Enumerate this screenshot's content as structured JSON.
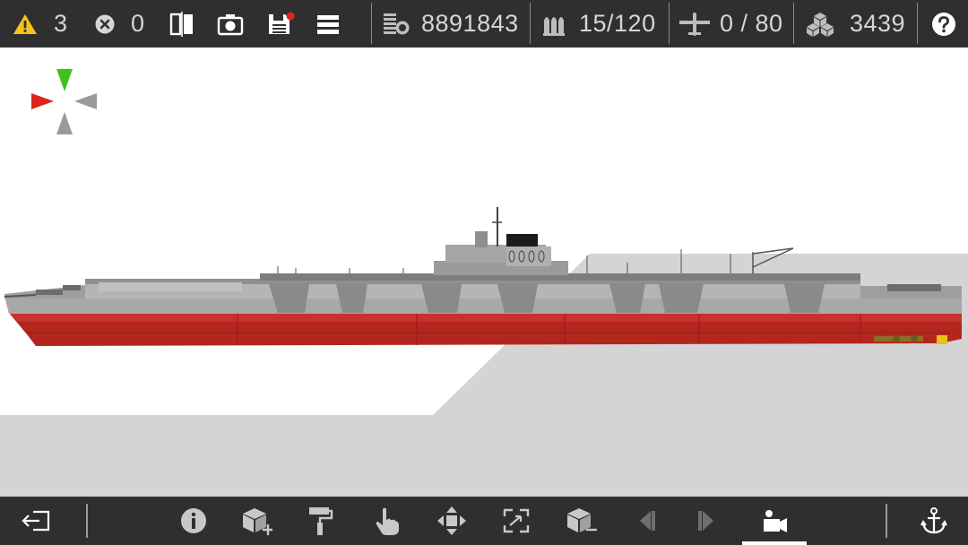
{
  "toolbar": {
    "warnings_count": "3",
    "errors_count": "0",
    "cost": "8891843",
    "ammo": "15/120",
    "aircraft": "0 / 80",
    "weight": "3439"
  },
  "icons": {
    "warning": "warning-triangle-icon",
    "error": "error-x-icon",
    "mirror": "mirror-view-icon",
    "camera": "camera-icon",
    "save": "save-icon",
    "menu": "menu-icon",
    "cost": "cost-icon",
    "ammo": "ammo-icon",
    "aircraft": "aircraft-icon",
    "weight": "weight-icon",
    "help": "help-icon",
    "exit": "exit-icon",
    "info": "info-icon",
    "add_part": "add-part-icon",
    "paint": "paint-roller-icon",
    "select": "hand-pointer-icon",
    "move": "move-arrows-icon",
    "resize": "resize-icon",
    "remove_part": "remove-part-icon",
    "prev": "previous-icon",
    "next": "next-icon",
    "camera_view": "camera-view-icon",
    "anchor": "anchor-icon"
  },
  "colors": {
    "bar_bg": "#2f2f2f",
    "warning_yellow": "#f5c518",
    "hull_red": "#b3261e",
    "hull_grey": "#a8a8a8",
    "nav_green": "#3cc21a",
    "nav_red": "#e0241b",
    "save_dot": "#e0241b"
  }
}
